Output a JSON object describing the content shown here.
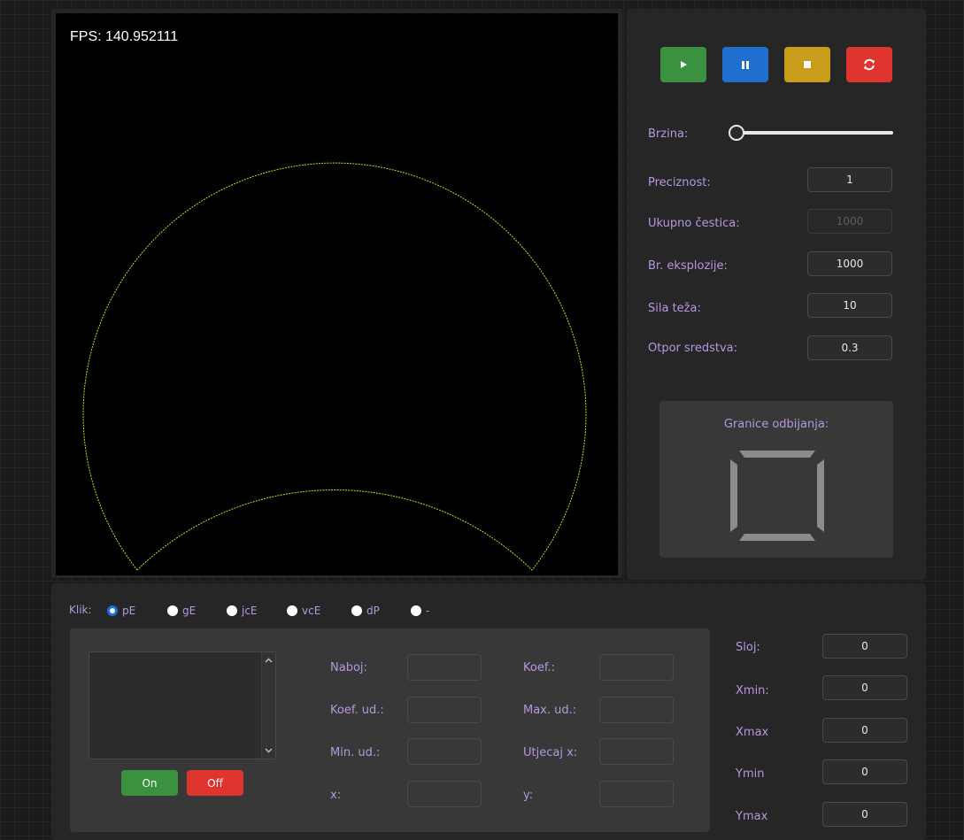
{
  "canvas": {
    "fps_text": "FPS: 140.952111"
  },
  "controls": {
    "speed_label": "Brzina:",
    "speed_value": 0.0,
    "fields": [
      {
        "label": "Preciznost:",
        "value": "1",
        "disabled": false
      },
      {
        "label": "Ukupno čestica:",
        "value": "1000",
        "disabled": true
      },
      {
        "label": "Br. eksplozije:",
        "value": "1000",
        "disabled": false
      },
      {
        "label": "Sila teža:",
        "value": "10",
        "disabled": false
      },
      {
        "label": "Otpor sredstva:",
        "value": "0.3",
        "disabled": false
      }
    ],
    "bounds_title": "Granice odbijanja:"
  },
  "click_mode": {
    "label": "Klik:",
    "options": [
      "pE",
      "gE",
      "jcE",
      "vcE",
      "dP",
      "-"
    ],
    "selected": "pE"
  },
  "params": {
    "on_label": "On",
    "off_label": "Off",
    "left_labels": [
      "Naboj:",
      "Koef. ud.:",
      "Min. ud.:",
      "x:"
    ],
    "right_labels": [
      "Koef.:",
      "Max. ud.:",
      "Utjecaj x:",
      "y:"
    ]
  },
  "layer": {
    "rows": [
      {
        "label": "Sloj:",
        "value": "0"
      },
      {
        "label": "Xmin:",
        "value": "0"
      },
      {
        "label": "Xmax",
        "value": "0"
      },
      {
        "label": "Ymin",
        "value": "0"
      },
      {
        "label": "Ymax",
        "value": "0"
      }
    ]
  },
  "colors": {
    "curve": "#d8d020",
    "play": "#3a9140",
    "pause": "#1f6fcf",
    "stop": "#c99d1a",
    "reset": "#e0352e",
    "label": "#b598e0"
  }
}
